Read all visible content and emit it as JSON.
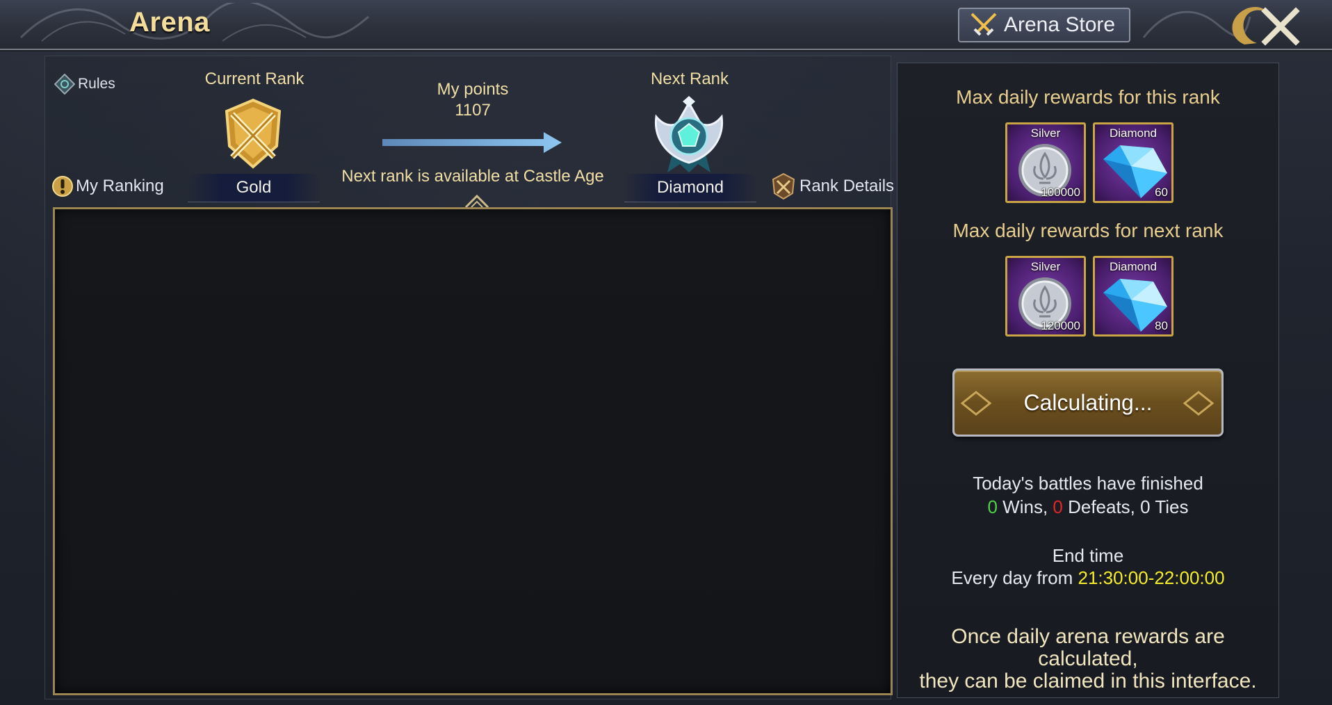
{
  "header": {
    "title": "Arena",
    "store_label": "Arena Store"
  },
  "left": {
    "rules_label": "Rules",
    "current_rank_label": "Current Rank",
    "current_rank": "Gold",
    "points_label": "My points",
    "points_value": "1107",
    "next_rank_note": "Next rank is available at Castle Age",
    "next_rank_label": "Next Rank",
    "next_rank": "Diamond",
    "my_ranking_label": "My Ranking",
    "rank_details_label": "Rank Details"
  },
  "right": {
    "this_rank_heading": "Max daily rewards for this rank",
    "next_rank_heading": "Max daily rewards for next rank",
    "this_rank_rewards": [
      {
        "name": "Silver",
        "count": "100000"
      },
      {
        "name": "Diamond",
        "count": "60"
      }
    ],
    "next_rank_rewards": [
      {
        "name": "Silver",
        "count": "120000"
      },
      {
        "name": "Diamond",
        "count": "80"
      }
    ],
    "calc_button": "Calculating...",
    "battles_status": "Today's battles have finished",
    "wins_count": "0",
    "wins_label": " Wins, ",
    "defeats_count": "0",
    "defeats_label": " Defeats, ",
    "ties_text": "0 Ties",
    "end_time_label": "End time",
    "every_day_prefix": "Every day from ",
    "time_range": "21:30:00-22:00:00",
    "note_line1": "Once daily arena rewards are calculated,",
    "note_line2": "they can be claimed in this interface."
  },
  "colors": {
    "gold_text": "#f2dfa5",
    "wins": "#4fd34a",
    "defeats": "#e02626",
    "time": "#f6ee2a"
  }
}
